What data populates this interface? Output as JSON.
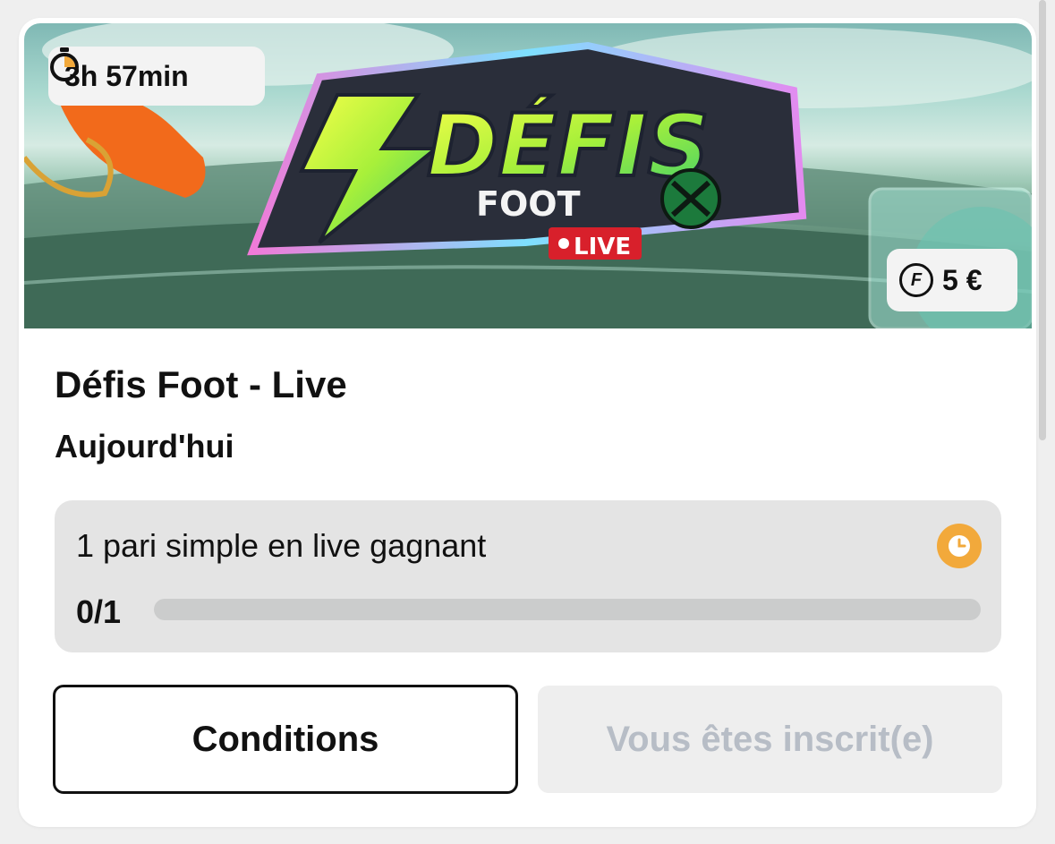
{
  "banner": {
    "logo_main": "DÉFIS",
    "logo_sub": "FOOT",
    "logo_live": "LIVE",
    "timer": "3h 57min",
    "reward": "5 €",
    "reward_coin_letter": "F"
  },
  "challenge": {
    "title": "Défis Foot - Live",
    "date": "Aujourd'hui"
  },
  "mission": {
    "label": "1 pari simple en live gagnant",
    "progress_text": "0/1",
    "progress_fraction": 0,
    "status_icon": "clock-icon"
  },
  "actions": {
    "conditions_label": "Conditions",
    "registered_label": "Vous êtes inscrit(e)"
  },
  "colors": {
    "accent": "#f2a93b",
    "disabled_text": "#b7bdc6"
  }
}
